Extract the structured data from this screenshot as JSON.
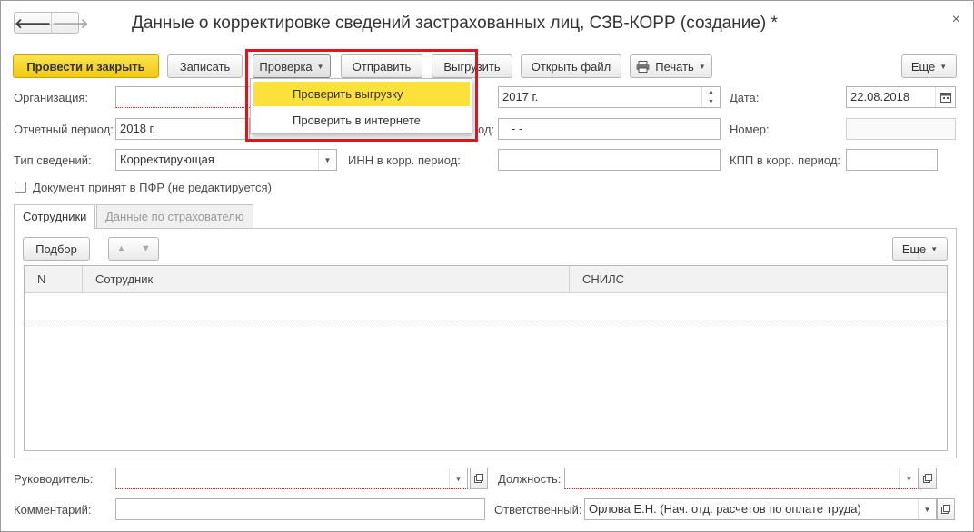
{
  "window": {
    "title": "Данные о корректировке сведений застрахованных лиц, СЗВ-КОРР (создание) *",
    "close": "×",
    "back": "🡐",
    "forward": "🡒"
  },
  "toolbar": {
    "post_close": "Провести и закрыть",
    "save": "Записать",
    "check": "Проверка",
    "send": "Отправить",
    "export": "Выгрузить",
    "open_file": "Открыть файл",
    "print": "Печать",
    "more": "Еще"
  },
  "check_menu": {
    "items": [
      "Проверить выгрузку",
      "Проверить в интернете"
    ],
    "selected": 0
  },
  "form": {
    "org_label": "Организация:",
    "org_value": "",
    "year_value": "2017 г.",
    "date_label": "Дата:",
    "date_value": "22.08.2018",
    "period_label": "Отчетный период:",
    "period_value": "2018 г.",
    "corr_period_label_tail": "од:",
    "corr_period_value": "-  -",
    "number_label": "Номер:",
    "number_value": "",
    "type_label": "Тип сведений:",
    "type_value": "Корректирующая",
    "inn_label": "ИНН в корр. период:",
    "inn_value": "",
    "kpp_label": "КПП в корр. период:",
    "kpp_value": "",
    "pfr_accepted_label": "Документ принят в ПФР (не редактируется)"
  },
  "tabs": [
    {
      "label": "Сотрудники",
      "active": true
    },
    {
      "label": "Данные по страхователю",
      "active": false
    }
  ],
  "employees": {
    "select_btn": "Подбор",
    "more": "Еще",
    "columns": [
      "N",
      "Сотрудник",
      "СНИЛС"
    ],
    "rows": []
  },
  "footer": {
    "head_label": "Руководитель:",
    "head_value": "",
    "position_label": "Должность:",
    "position_value": "",
    "comment_label": "Комментарий:",
    "comment_value": "",
    "responsible_label": "Ответственный:",
    "responsible_value": "Орлова Е.Н. (Нач. отд. расчетов по оплате труда)"
  },
  "colors": {
    "primary": "#f4d11f",
    "menu_selected": "#fbe13a",
    "highlight": "#e0141e"
  }
}
